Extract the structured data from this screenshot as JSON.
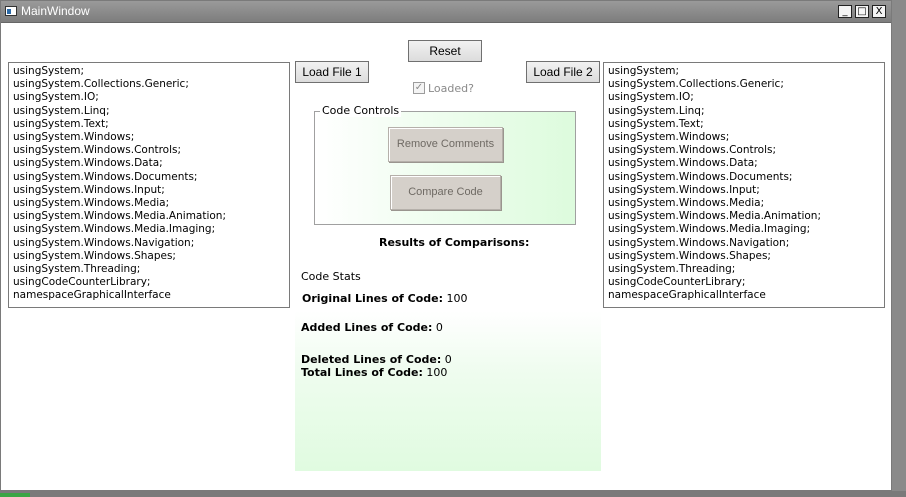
{
  "window": {
    "title": "MainWindow",
    "minimize_glyph": "_",
    "maximize_glyph": "□",
    "close_glyph": "X"
  },
  "toolbar": {
    "reset_label": "Reset",
    "load_file_1_label": "Load File 1",
    "load_file_2_label": "Load File 2",
    "loaded_label": "Loaded?",
    "loaded_checked": true
  },
  "code_controls": {
    "legend": "Code Controls",
    "remove_comments_label": "Remove Comments",
    "compare_code_label": "Compare Code"
  },
  "results": {
    "heading": "Results of Comparisons:",
    "code_stats_label": "Code Stats",
    "original_label": "Original Lines of Code:",
    "original_value": "100",
    "added_label": "Added Lines of Code:",
    "added_value": "0",
    "deleted_label": "Deleted Lines of Code:",
    "deleted_value": "0",
    "total_label": "Total Lines of Code:",
    "total_value": "100"
  },
  "file1_lines": [
    "usingSystem;",
    "usingSystem.Collections.Generic;",
    "usingSystem.IO;",
    "usingSystem.Linq;",
    "usingSystem.Text;",
    "usingSystem.Windows;",
    "usingSystem.Windows.Controls;",
    "usingSystem.Windows.Data;",
    "usingSystem.Windows.Documents;",
    "usingSystem.Windows.Input;",
    "usingSystem.Windows.Media;",
    "usingSystem.Windows.Media.Animation;",
    "usingSystem.Windows.Media.Imaging;",
    "usingSystem.Windows.Navigation;",
    "usingSystem.Windows.Shapes;",
    "usingSystem.Threading;",
    "usingCodeCounterLibrary;",
    "namespaceGraphicalInterface"
  ],
  "file2_lines": [
    "usingSystem;",
    "usingSystem.Collections.Generic;",
    "usingSystem.IO;",
    "usingSystem.Linq;",
    "usingSystem.Text;",
    "usingSystem.Windows;",
    "usingSystem.Windows.Controls;",
    "usingSystem.Windows.Data;",
    "usingSystem.Windows.Documents;",
    "usingSystem.Windows.Input;",
    "usingSystem.Windows.Media;",
    "usingSystem.Windows.Media.Animation;",
    "usingSystem.Windows.Media.Imaging;",
    "usingSystem.Windows.Navigation;",
    "usingSystem.Windows.Shapes;",
    "usingSystem.Threading;",
    "usingCodeCounterLibrary;",
    "namespaceGraphicalInterface"
  ]
}
